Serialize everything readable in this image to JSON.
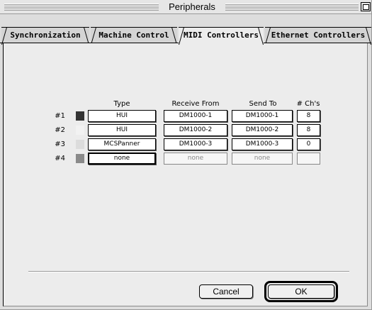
{
  "window": {
    "title": "Peripherals"
  },
  "tabs": [
    {
      "label": "Synchronization",
      "active": false
    },
    {
      "label": "Machine Control",
      "active": false
    },
    {
      "label": "MIDI Controllers",
      "active": true
    },
    {
      "label": "Ethernet Controllers",
      "active": false
    }
  ],
  "table": {
    "headers": {
      "type": "Type",
      "receive": "Receive From",
      "send": "Send To",
      "channels": "# Ch's"
    },
    "rows": [
      {
        "label": "#1",
        "color": "#333333",
        "type": "HUI",
        "receive": "DM1000-1",
        "send": "DM1000-1",
        "channels": "8",
        "enabled": true
      },
      {
        "label": "#2",
        "color": "#f2f2f2",
        "type": "HUI",
        "receive": "DM1000-2",
        "send": "DM1000-2",
        "channels": "8",
        "enabled": true
      },
      {
        "label": "#3",
        "color": "#dcdcdc",
        "type": "MCSPanner",
        "receive": "DM1000-3",
        "send": "DM1000-3",
        "channels": "0",
        "enabled": true
      },
      {
        "label": "#4",
        "color": "#8a8a8a",
        "type": "none",
        "receive": "none",
        "send": "none",
        "channels": "",
        "enabled": false
      }
    ]
  },
  "buttons": {
    "cancel": "Cancel",
    "ok": "OK"
  }
}
